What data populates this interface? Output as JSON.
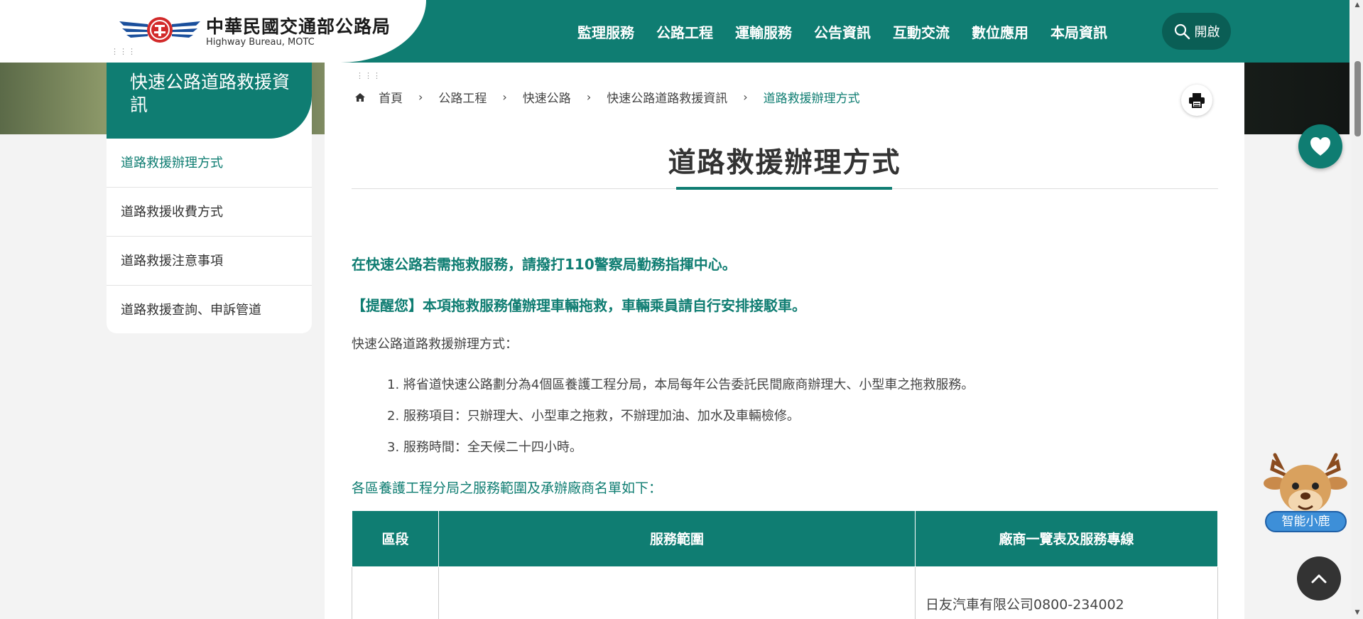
{
  "header": {
    "logo_cn": "中華民國交通部公路局",
    "logo_en": "Highway Bureau, MOTC",
    "nav": [
      "監理服務",
      "公路工程",
      "運輸服務",
      "公告資訊",
      "互動交流",
      "數位應用",
      "本局資訊"
    ],
    "search_label": "開啟"
  },
  "sidebar": {
    "title": "快速公路道路救援資訊",
    "items": [
      "道路救援辦理方式",
      "道路救援收費方式",
      "道路救援注意事項",
      "道路救援查詢、申訴管道"
    ]
  },
  "breadcrumb": {
    "items": [
      "首頁",
      "公路工程",
      "快速公路",
      "快速公路道路救援資訊"
    ],
    "current": "道路救援辦理方式"
  },
  "content": {
    "title": "道路救援辦理方式",
    "lead1": "在快速公路若需拖救服務，請撥打110警察局勤務指揮中心。",
    "lead2": "【提醒您】本項拖救服務僅辦理車輛拖救，車輛乘員請自行安排接駁車。",
    "intro": "快速公路道路救援辦理方式：",
    "list": [
      "1. 將省道快速公路劃分為4個區養護工程分局，本局每年公告委託民間廠商辦理大、小型車之拖救服務。",
      "2. 服務項目：只辦理大、小型車之拖救，不辦理加油、加水及車輛檢修。",
      "3. 服務時間：全天候二十四小時。"
    ],
    "table_intro": "各區養護工程分局之服務範圍及承辦廠商名單如下：",
    "table": {
      "headers": [
        "區段",
        "服務範圍",
        "廠商一覽表及服務專線"
      ],
      "rows": [
        [
          "",
          "",
          "日友汽車有限公司0800-234002"
        ]
      ]
    }
  },
  "floating": {
    "assistant_label": "智能小鹿"
  },
  "colors": {
    "brand": "#0f7d72",
    "brand_dark": "#0a5e55"
  }
}
